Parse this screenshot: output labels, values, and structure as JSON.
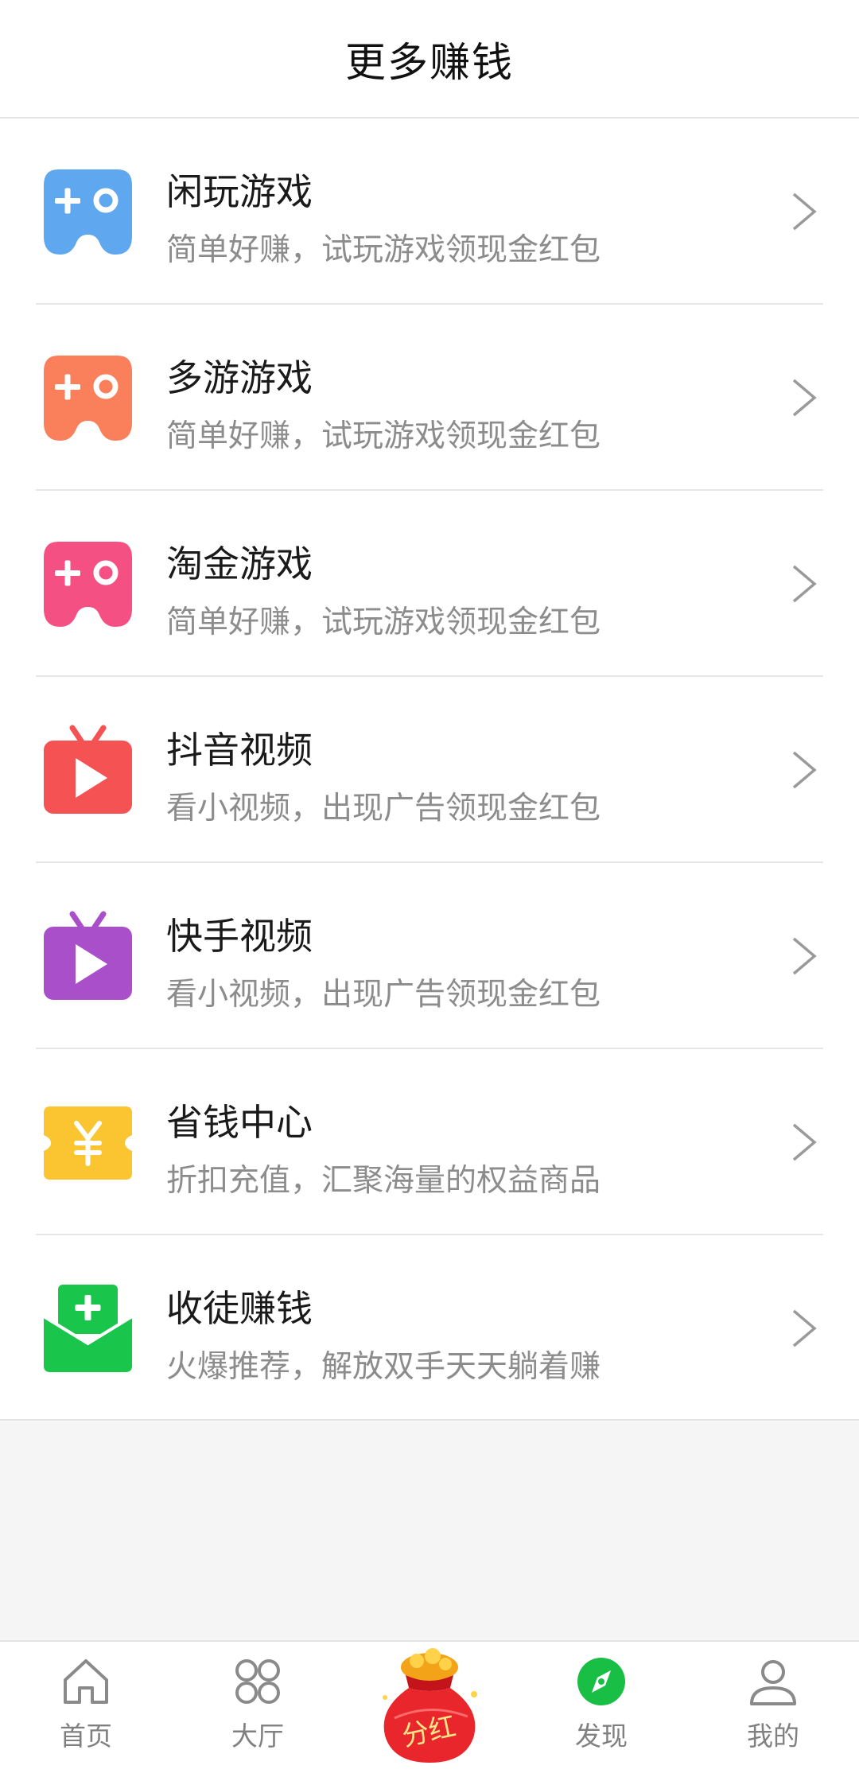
{
  "header": {
    "title": "更多赚钱"
  },
  "items": [
    {
      "title": "闲玩游戏",
      "desc": "简单好赚，试玩游戏领现金红包",
      "icon": "gamepad-icon",
      "color": "#5fa8f0"
    },
    {
      "title": "多游游戏",
      "desc": "简单好赚，试玩游戏领现金红包",
      "icon": "gamepad-icon",
      "color": "#f9805a"
    },
    {
      "title": "淘金游戏",
      "desc": "简单好赚，试玩游戏领现金红包",
      "icon": "gamepad-icon",
      "color": "#f45083"
    },
    {
      "title": "抖音视频",
      "desc": "看小视频，出现广告领现金红包",
      "icon": "tv-play-icon",
      "color": "#f55353"
    },
    {
      "title": "快手视频",
      "desc": "看小视频，出现广告领现金红包",
      "icon": "tv-play-icon",
      "color": "#a94fca"
    },
    {
      "title": "省钱中心",
      "desc": "折扣充值，汇聚海量的权益商品",
      "icon": "yuan-ticket-icon",
      "color": "#fbc531"
    },
    {
      "title": "收徒赚钱",
      "desc": "火爆推荐，解放双手天天躺着赚",
      "icon": "envelope-plus-icon",
      "color": "#19c54b"
    }
  ],
  "tabbar": {
    "tabs": [
      {
        "label": "首页",
        "icon": "home-icon",
        "active": false
      },
      {
        "label": "大厅",
        "icon": "grid-icon",
        "active": false
      },
      {
        "label": "",
        "icon": "money-bag-icon",
        "active": false
      },
      {
        "label": "发现",
        "icon": "compass-icon",
        "active": true
      },
      {
        "label": "我的",
        "icon": "user-icon",
        "active": false
      }
    ],
    "center_badge": "分红",
    "active_color": "#19bf45",
    "inactive_color": "#808080"
  }
}
